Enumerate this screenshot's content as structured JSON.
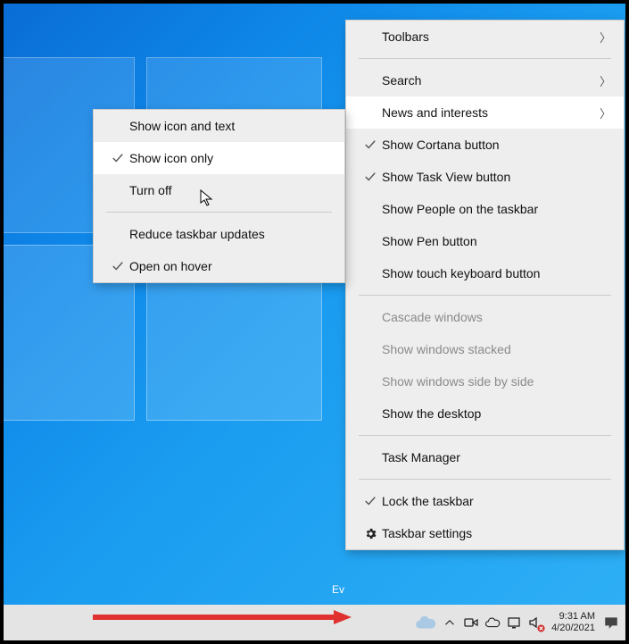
{
  "desktop": {
    "eval_label": "Ev"
  },
  "taskbar_context_menu": {
    "toolbars": "Toolbars",
    "search": "Search",
    "news_interests": "News and interests",
    "cortana": "Show Cortana button",
    "taskview": "Show Task View button",
    "people": "Show People on the taskbar",
    "pen": "Show Pen button",
    "touch_kbd": "Show touch keyboard button",
    "cascade": "Cascade windows",
    "stacked": "Show windows stacked",
    "sidebyside": "Show windows side by side",
    "showdesk": "Show the desktop",
    "taskmgr": "Task Manager",
    "lock": "Lock the taskbar",
    "settings": "Taskbar settings"
  },
  "news_submenu": {
    "icon_text": "Show icon and text",
    "icon_only": "Show icon only",
    "turn_off": "Turn off",
    "reduce": "Reduce taskbar updates",
    "open_hover": "Open on hover"
  },
  "taskbar": {
    "time": "9:31 AM",
    "date": "4/20/2021"
  }
}
